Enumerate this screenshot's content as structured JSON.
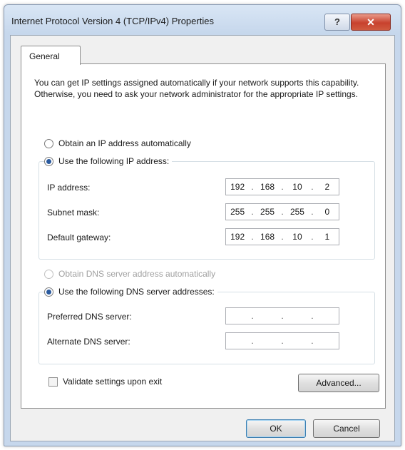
{
  "window": {
    "title": "Internet Protocol Version 4 (TCP/IPv4) Properties",
    "help_label": "?",
    "close_label": "✕"
  },
  "tabs": [
    {
      "label": "General"
    }
  ],
  "intro_text": "You can get IP settings assigned automatically if your network supports this capability. Otherwise, you need to ask your network administrator for the appropriate IP settings.",
  "ip_section": {
    "auto_label": "Obtain an IP address automatically",
    "manual_label": "Use the following IP address:",
    "selected": "manual",
    "fields": [
      {
        "label": "IP address:",
        "octets": [
          "192",
          "168",
          "10",
          "2"
        ]
      },
      {
        "label": "Subnet mask:",
        "octets": [
          "255",
          "255",
          "255",
          "0"
        ]
      },
      {
        "label": "Default gateway:",
        "octets": [
          "192",
          "168",
          "10",
          "1"
        ]
      }
    ]
  },
  "dns_section": {
    "auto_label": "Obtain DNS server address automatically",
    "manual_label": "Use the following DNS server addresses:",
    "selected": "manual",
    "fields": [
      {
        "label": "Preferred DNS server:",
        "octets": [
          "",
          "",
          "",
          ""
        ]
      },
      {
        "label": "Alternate DNS server:",
        "octets": [
          "",
          "",
          "",
          ""
        ]
      }
    ]
  },
  "validate_label": "Validate settings upon exit",
  "buttons": {
    "advanced": "Advanced...",
    "ok": "OK",
    "cancel": "Cancel"
  }
}
